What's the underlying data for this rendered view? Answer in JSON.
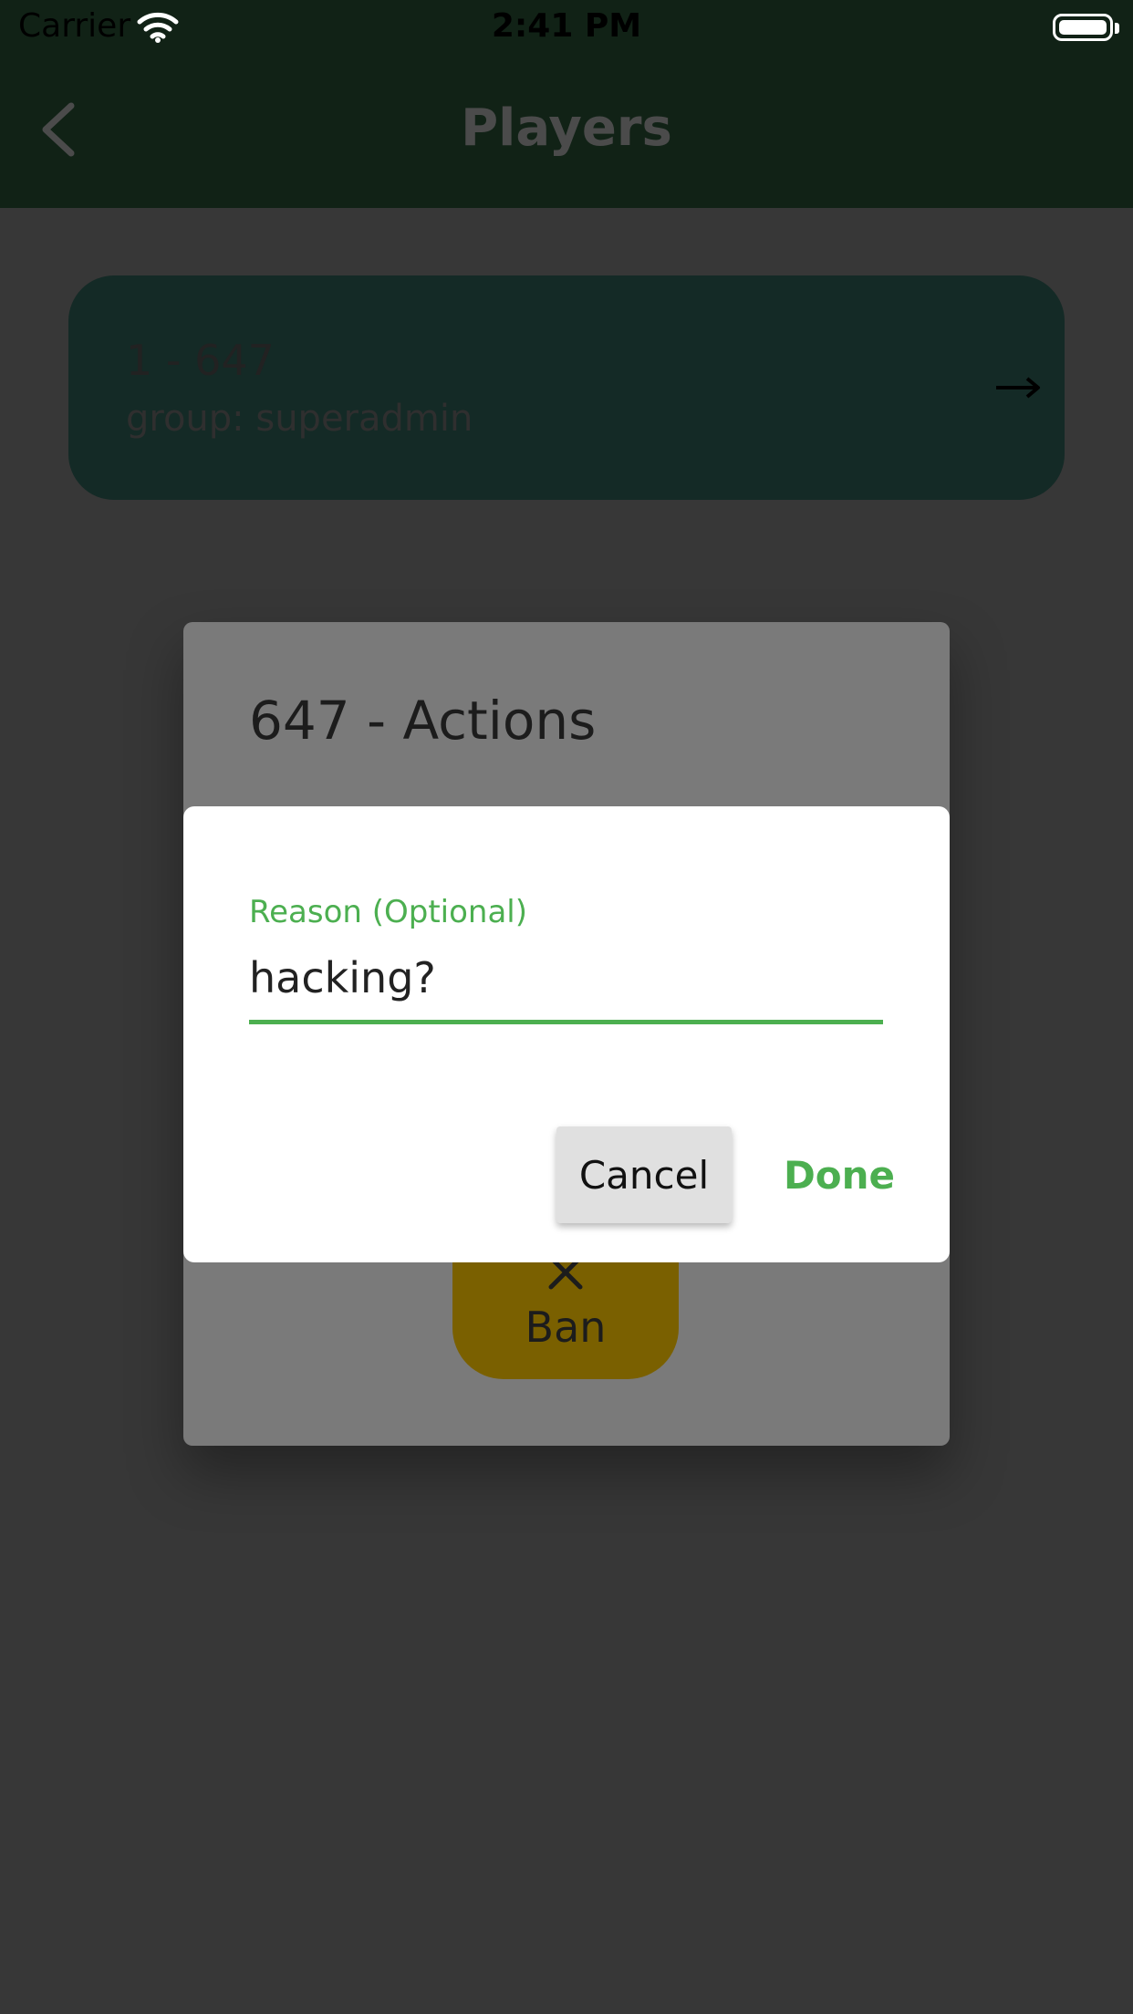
{
  "status_bar": {
    "carrier": "Carrier",
    "time": "2:41 PM",
    "icons": [
      "wifi-icon",
      "battery-icon"
    ]
  },
  "app_bar": {
    "title": "Players",
    "back_icon": "chevron-left-icon"
  },
  "player_card": {
    "name": "1 - 647",
    "group": "group: superadmin",
    "arrow_icon": "arrow-right-icon"
  },
  "actions_dialog": {
    "title": "647 - Actions",
    "ban_button": {
      "label": "Ban",
      "icon": "close-icon"
    }
  },
  "reason_dialog": {
    "field_label": "Reason (Optional)",
    "field_value": "hacking?",
    "cancel_label": "Cancel",
    "done_label": "Done"
  },
  "colors": {
    "app_bar_bg": "#112216",
    "accent_green": "#4caf50",
    "scrim_bg": "#373737",
    "ban_button_bg": "#7a6000"
  }
}
